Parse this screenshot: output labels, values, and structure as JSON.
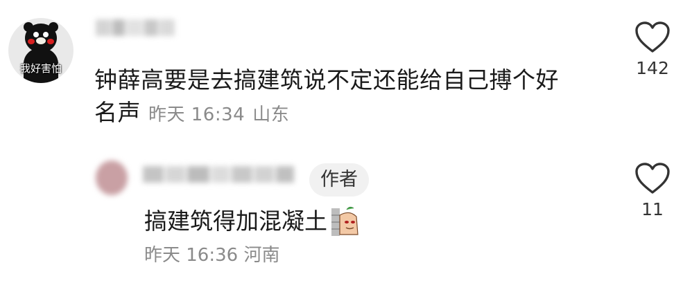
{
  "comments": [
    {
      "avatar_caption": "我好害怕",
      "text": "钟薛高要是去搞建筑说不定还能给自己搏个好名声",
      "time": "昨天 16:34",
      "location": "山东",
      "likes": "142"
    }
  ],
  "reply": {
    "badge": "作者",
    "text": "搞建筑得加混凝土",
    "time": "昨天 16:36",
    "location": "河南",
    "likes": "11"
  },
  "colors": {
    "text": "#1a1a1a",
    "meta": "#8a8a8a",
    "badge_bg": "#f1f1f1"
  }
}
